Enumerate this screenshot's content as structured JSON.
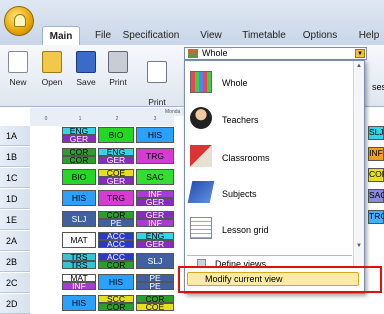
{
  "tabs": [
    "Main",
    "File",
    "Specification",
    "View",
    "Timetable",
    "Options",
    "Help"
  ],
  "ribbon": {
    "buttons": [
      "New",
      "Open",
      "Save",
      "Print",
      "Print\npreview"
    ],
    "right_partial": "ses"
  },
  "view_select": {
    "value": "Whole"
  },
  "menu": {
    "items": [
      "Whole",
      "Teachers",
      "Classrooms",
      "Subjects",
      "Lesson grid"
    ],
    "footer": [
      "Define views",
      "Modify current view"
    ]
  },
  "grid": {
    "header_fragment": "Monda",
    "col_numbers": [
      "0",
      "1",
      "2",
      "3"
    ],
    "rows": [
      {
        "label": "1A",
        "cells": [
          [
            "ENG",
            "GER"
          ],
          [
            "BIO"
          ],
          [
            "HIS"
          ]
        ]
      },
      {
        "label": "1B",
        "cells": [
          [
            "COR",
            "COR"
          ],
          [
            "ENG",
            "GER"
          ],
          [
            "TRG"
          ]
        ]
      },
      {
        "label": "1C",
        "cells": [
          [
            "BIO"
          ],
          [
            "COE",
            "GER"
          ],
          [
            "SAC"
          ]
        ]
      },
      {
        "label": "1D",
        "cells": [
          [
            "HIS"
          ],
          [
            "TRG"
          ],
          [
            "INF",
            "GER"
          ]
        ]
      },
      {
        "label": "1E",
        "cells": [
          [
            "SLJ"
          ],
          [
            "COR",
            "PE"
          ],
          [
            "GER",
            "INF"
          ]
        ]
      },
      {
        "label": "2A",
        "cells": [
          [
            "MAT"
          ],
          [
            "ACC",
            "ACC"
          ],
          [
            "ENG",
            "GER"
          ]
        ]
      },
      {
        "label": "2B",
        "cells": [
          [
            "TRS",
            "TRS"
          ],
          [
            "ACC",
            "COR"
          ],
          [
            "SLJ"
          ]
        ]
      },
      {
        "label": "2C",
        "cells": [
          [
            "MAT",
            "INF"
          ],
          [
            "HIS"
          ],
          [
            "PE",
            "PE"
          ]
        ]
      },
      {
        "label": "2D",
        "cells": [
          [
            "HIS"
          ],
          [
            "SCC",
            "COR"
          ],
          [
            "COR",
            "COE"
          ]
        ]
      }
    ],
    "right_partial": [
      "SLJ",
      "INF",
      "COF",
      "SAC",
      "TRG"
    ]
  },
  "colors": {
    "accent": "#f0c040",
    "highlight": "#fde9a8",
    "callout": "#e01010"
  }
}
